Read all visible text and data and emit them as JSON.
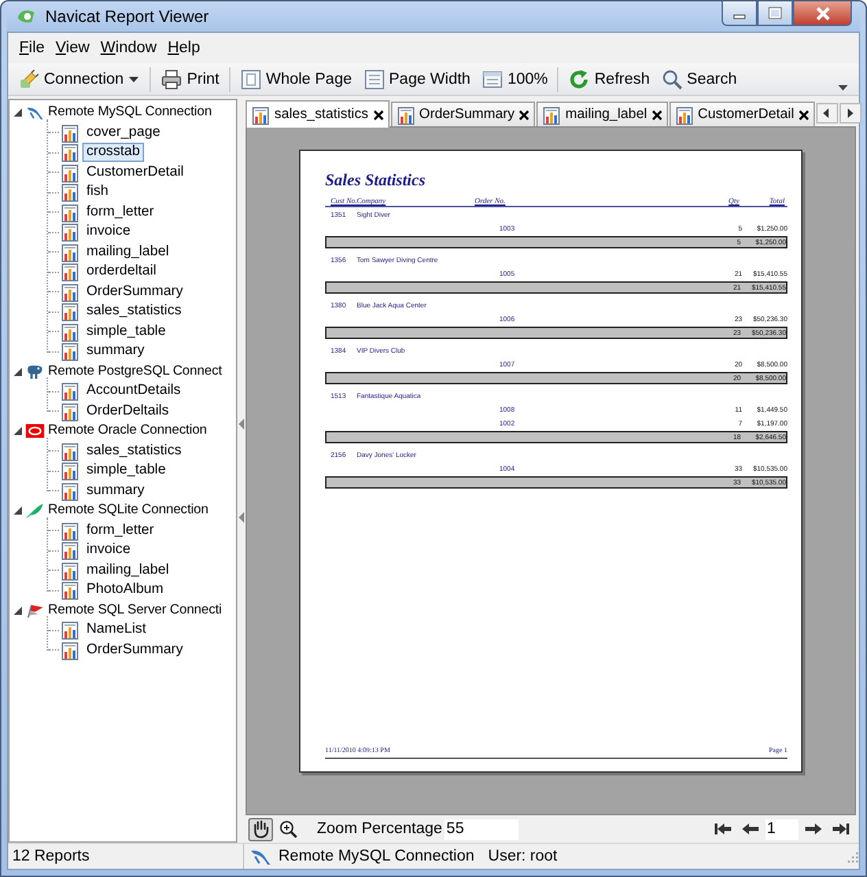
{
  "window": {
    "title": "Navicat Report Viewer"
  },
  "menu": [
    {
      "label": "File"
    },
    {
      "label": "View"
    },
    {
      "label": "Window"
    },
    {
      "label": "Help"
    }
  ],
  "toolbar": [
    {
      "kind": "dropdown",
      "label": "Connection"
    },
    {
      "kind": "button",
      "label": "Print"
    },
    {
      "kind": "separator"
    },
    {
      "kind": "button",
      "label": "Whole Page"
    },
    {
      "kind": "button",
      "label": "Page Width"
    },
    {
      "kind": "button",
      "label": "100%"
    },
    {
      "kind": "separator"
    },
    {
      "kind": "button",
      "label": "Refresh"
    },
    {
      "kind": "button",
      "label": "Search"
    }
  ],
  "tree": [
    {
      "label": "Remote MySQL Connection",
      "expanded": true,
      "children": [
        {
          "label": "cover_page",
          "selected": false
        },
        {
          "label": "crosstab",
          "selected": true
        },
        {
          "label": "CustomerDetail",
          "selected": false
        },
        {
          "label": "fish",
          "selected": false
        },
        {
          "label": "form_letter",
          "selected": false
        },
        {
          "label": "invoice",
          "selected": false
        },
        {
          "label": "mailing_label",
          "selected": false
        },
        {
          "label": "orderdeltail",
          "selected": false
        },
        {
          "label": "OrderSummary",
          "selected": false
        },
        {
          "label": "sales_statistics",
          "selected": false
        },
        {
          "label": "simple_table",
          "selected": false
        },
        {
          "label": "summary",
          "selected": false
        }
      ]
    },
    {
      "label": "Remote PostgreSQL Connect",
      "expanded": true,
      "children": [
        {
          "label": "AccountDetails",
          "selected": false
        },
        {
          "label": "OrderDeltails",
          "selected": false
        }
      ]
    },
    {
      "label": "Remote Oracle Connection",
      "expanded": true,
      "children": [
        {
          "label": "sales_statistics",
          "selected": false
        },
        {
          "label": "simple_table",
          "selected": false
        },
        {
          "label": "summary",
          "selected": false
        }
      ]
    },
    {
      "label": "Remote SQLite Connection",
      "expanded": true,
      "children": [
        {
          "label": "form_letter",
          "selected": false
        },
        {
          "label": "invoice",
          "selected": false
        },
        {
          "label": "mailing_label",
          "selected": false
        },
        {
          "label": "PhotoAlbum",
          "selected": false
        }
      ]
    },
    {
      "label": "Remote SQL Server Connecti",
      "expanded": true,
      "children": [
        {
          "label": "NameList",
          "selected": false
        },
        {
          "label": "OrderSummary",
          "selected": false
        }
      ]
    }
  ],
  "tabs": [
    {
      "label": "sales_statistics",
      "selected": true
    },
    {
      "label": "OrderSummary",
      "selected": false
    },
    {
      "label": "mailing_label",
      "selected": false
    },
    {
      "label": "CustomerDetail",
      "selected": false
    }
  ],
  "report": {
    "title": "Sales Statistics",
    "columns": [
      "Cust No.",
      "Company",
      "Order No.",
      "Qty",
      "Total"
    ],
    "groups": [
      {
        "cust_no": "1351",
        "company": "Sight Diver",
        "orders": [
          {
            "order_no": "1003",
            "qty": "5",
            "total": "$1,250.00"
          }
        ],
        "sum_qty": "5",
        "sum_total": "$1,250.00"
      },
      {
        "cust_no": "1356",
        "company": "Tom Sawyer Diving Centre",
        "orders": [
          {
            "order_no": "1005",
            "qty": "21",
            "total": "$15,410.55"
          }
        ],
        "sum_qty": "21",
        "sum_total": "$15,410.55"
      },
      {
        "cust_no": "1380",
        "company": "Blue Jack Aqua Center",
        "orders": [
          {
            "order_no": "1006",
            "qty": "23",
            "total": "$50,236.30"
          }
        ],
        "sum_qty": "23",
        "sum_total": "$50,236.30"
      },
      {
        "cust_no": "1384",
        "company": "VIP Divers Club",
        "orders": [
          {
            "order_no": "1007",
            "qty": "20",
            "total": "$8,500.00"
          }
        ],
        "sum_qty": "20",
        "sum_total": "$8,500.00"
      },
      {
        "cust_no": "1513",
        "company": "Fantastique Aquatica",
        "orders": [
          {
            "order_no": "1008",
            "qty": "11",
            "total": "$1,449.50"
          },
          {
            "order_no": "1002",
            "qty": "7",
            "total": "$1,197.00"
          }
        ],
        "sum_qty": "18",
        "sum_total": "$2,646.50"
      },
      {
        "cust_no": "2156",
        "company": "Davy Jones' Locker",
        "orders": [
          {
            "order_no": "1004",
            "qty": "33",
            "total": "$10,535.00"
          }
        ],
        "sum_qty": "33",
        "sum_total": "$10,535.00"
      }
    ],
    "footer_date": "11/11/2010 4:09:13 PM",
    "footer_page": "Page 1"
  },
  "viewer": {
    "tools": [
      {
        "kind": "hand",
        "selected": true
      },
      {
        "kind": "zoom",
        "selected": false
      }
    ],
    "zoom_label": "Zoom Percentage",
    "zoom_value": "55",
    "page": "1"
  },
  "status_bar": {
    "count": "12 Reports",
    "connection": "Remote MySQL Connection",
    "user": "User: root"
  }
}
